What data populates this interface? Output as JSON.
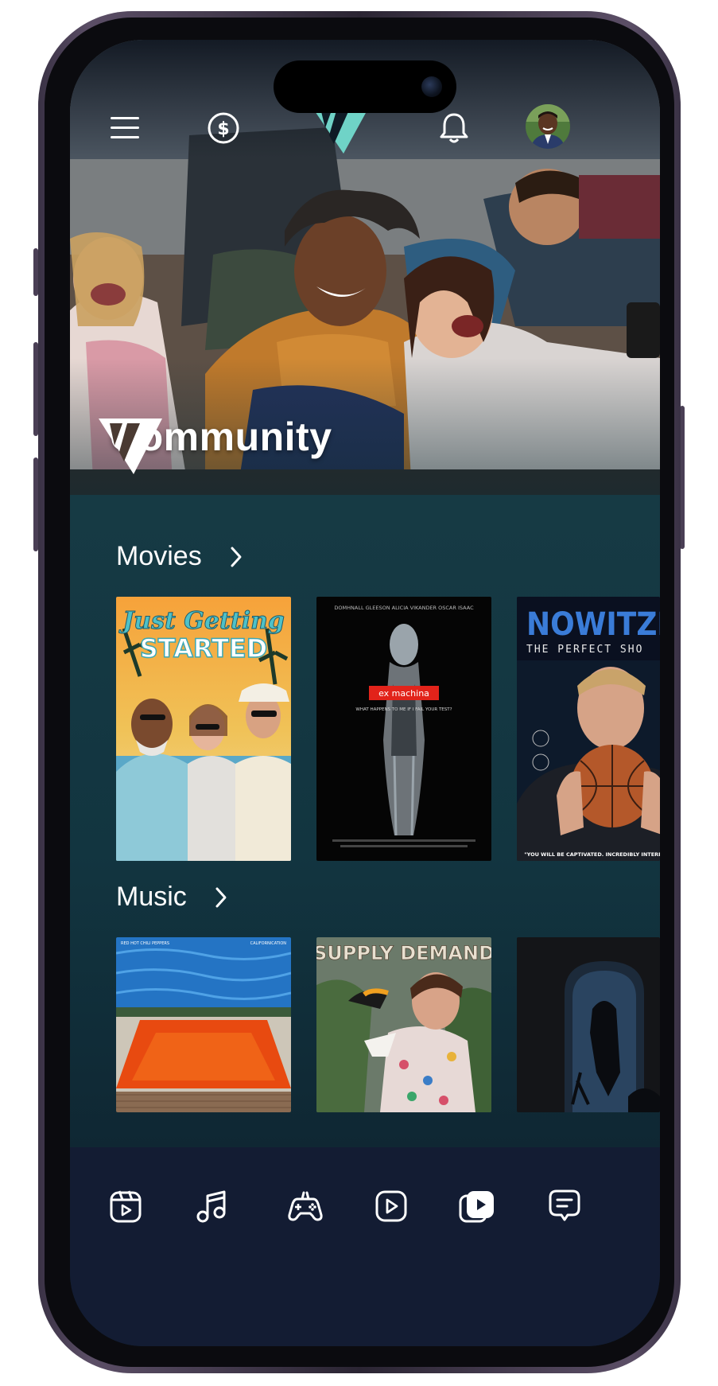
{
  "app": {
    "brand_color": "#6fd3c7",
    "background_color": "#102a33",
    "tabbar_color": "#131c33"
  },
  "header": {
    "menu_icon": "hamburger-menu-icon",
    "coin_icon": "dollar-coin-icon",
    "logo": "brand-logo",
    "notification_icon": "bell-icon",
    "avatar": "user-avatar"
  },
  "hero": {
    "title": "Community"
  },
  "sections": {
    "movies": {
      "title": "Movies",
      "items": [
        {
          "title_line1": "Just Getting",
          "title_line2": "STARTED"
        },
        {
          "credits": "DOMHNALL GLEESON   ALICIA VIKANDER   OSCAR ISAAC",
          "title": "ex machina",
          "tagline": "WHAT HAPPENS TO ME IF I FAIL YOUR TEST?"
        },
        {
          "title": "NOWITZKI",
          "subtitle": "THE PERFECT SHO",
          "quote": "\"YOU WILL BE CAPTIVATED. INCREDIBLY INTERESTING.\""
        }
      ]
    },
    "music": {
      "title": "Music",
      "items": [
        {
          "artist": "RED HOT CHILI PEPPERS",
          "album": "CALIFORNICATION"
        },
        {
          "title": "SUPPLY DEMAND"
        },
        {
          "title": ""
        }
      ]
    }
  },
  "tabbar": {
    "tabs": [
      {
        "icon": "video-calendar-icon",
        "active": false
      },
      {
        "icon": "music-note-icon",
        "active": false
      },
      {
        "icon": "game-controller-icon",
        "active": false
      },
      {
        "icon": "play-button-icon",
        "active": false
      },
      {
        "icon": "stacked-play-icon",
        "active": true
      },
      {
        "icon": "chat-bubble-icon",
        "active": false
      }
    ]
  }
}
